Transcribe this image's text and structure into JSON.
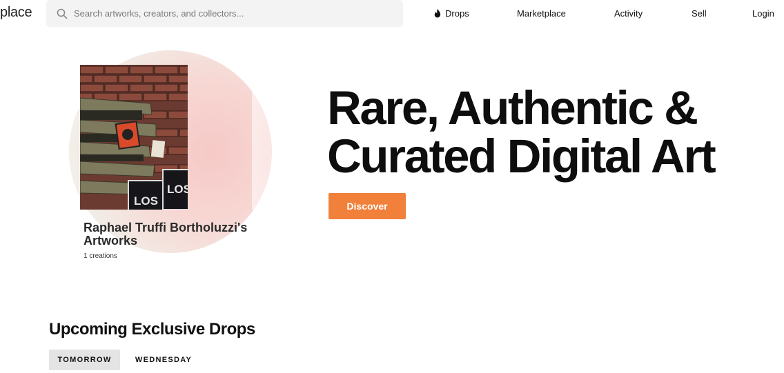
{
  "header": {
    "logo": "place",
    "search": {
      "placeholder": "Search artworks, creators, and collectors..."
    },
    "nav": [
      {
        "label": "Drops",
        "icon": "flame-icon"
      },
      {
        "label": "Marketplace"
      },
      {
        "label": "Activity"
      },
      {
        "label": "Sell"
      },
      {
        "label": "Login"
      }
    ]
  },
  "hero": {
    "card": {
      "title": "Raphael Truffi Bortholuzzi's Artworks",
      "count": "1 creations",
      "artwork_signs": [
        "LOS",
        "LOS"
      ]
    },
    "headline": "Rare, Authentic & Curated Digital Art",
    "discover_label": "Discover"
  },
  "drops": {
    "title": "Upcoming Exclusive Drops",
    "tabs": [
      {
        "label": "TOMORROW",
        "active": true
      },
      {
        "label": "WEDNESDAY",
        "active": false
      }
    ]
  },
  "colors": {
    "accent": "#f0803a",
    "tab_active_bg": "#e4e4e4",
    "search_bg": "#f3f3f3"
  }
}
